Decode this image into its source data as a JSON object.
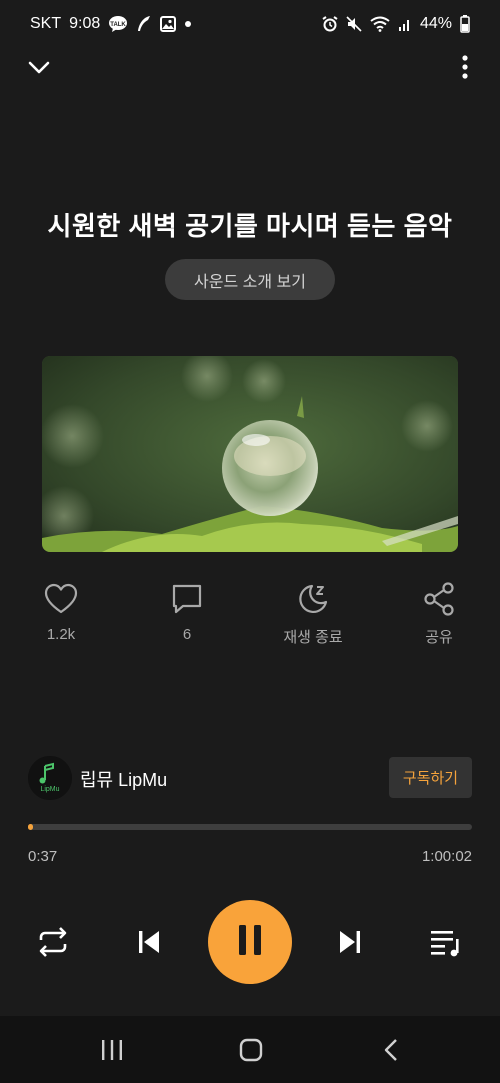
{
  "status_bar": {
    "carrier": "SKT",
    "time": "9:08",
    "battery": "44%",
    "left_icons": [
      "talk-icon",
      "feather-icon",
      "gallery-icon",
      "dot-icon"
    ],
    "right_icons": [
      "alarm-icon",
      "mute-icon",
      "wifi-icon",
      "signal-icon",
      "battery-icon"
    ]
  },
  "header": {
    "collapse_icon": "chevron-down-icon",
    "menu_icon": "more-vertical-icon"
  },
  "track": {
    "title": "시원한 새벽 공기를 마시며 듣는 음악",
    "intro_button": "사운드 소개 보기"
  },
  "actions": [
    {
      "icon": "heart-icon",
      "label": "1.2k"
    },
    {
      "icon": "comment-icon",
      "label": "6"
    },
    {
      "icon": "sleep-timer-icon",
      "label": "재생 종료"
    },
    {
      "icon": "share-icon",
      "label": "공유"
    }
  ],
  "channel": {
    "name": "립뮤 LipMu",
    "avatar_text": "LipMu",
    "subscribe_label": "구독하기"
  },
  "progress": {
    "current": "0:37",
    "total": "1:00:02",
    "fraction": 0.0103
  },
  "controls": {
    "repeat_icon": "repeat-icon",
    "prev_icon": "skip-previous-icon",
    "play_state_icon": "pause-icon",
    "next_icon": "skip-next-icon",
    "playlist_icon": "playlist-icon"
  },
  "colors": {
    "accent": "#f9a33a",
    "background": "#1b1b1b"
  }
}
